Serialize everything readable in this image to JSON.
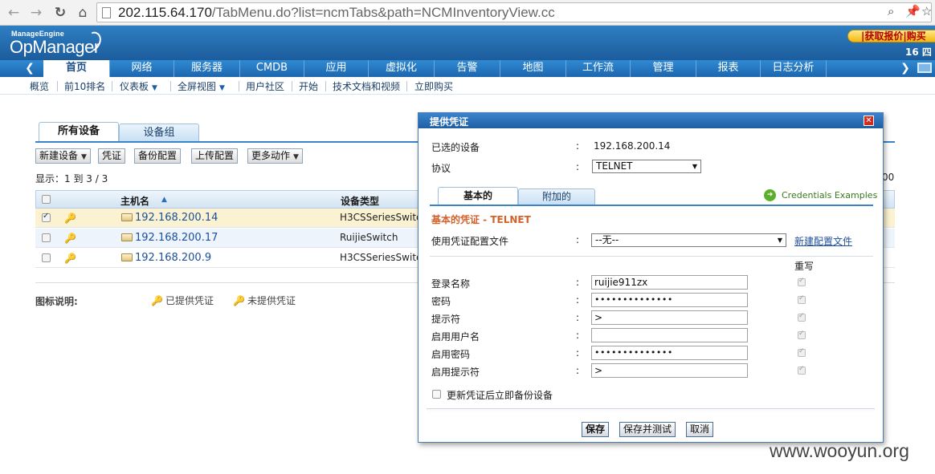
{
  "browser": {
    "url_host": "202.115.64.170",
    "url_path": "/TabMenu.do?list=ncmTabs&path=NCMInventoryView.cc"
  },
  "header": {
    "logo_small": "ManageEngine",
    "logo_big": "OpManager",
    "quote_button": "|获取报价|购买",
    "date_text": "16 四"
  },
  "main_nav": {
    "tabs": [
      {
        "label": "首页"
      },
      {
        "label": "网络"
      },
      {
        "label": "服务器"
      },
      {
        "label": "CMDB"
      },
      {
        "label": "应用"
      },
      {
        "label": "虚拟化"
      },
      {
        "label": "告警"
      },
      {
        "label": "地图"
      },
      {
        "label": "工作流"
      },
      {
        "label": "管理"
      },
      {
        "label": "报表"
      },
      {
        "label": "日志分析"
      }
    ]
  },
  "sub_nav": {
    "items": [
      {
        "label": "概览"
      },
      {
        "label": "前10排名"
      },
      {
        "label": "仪表板"
      },
      {
        "label": "全屏视图"
      },
      {
        "label": "用户社区"
      },
      {
        "label": "开始"
      },
      {
        "label": "技术文档和视频"
      },
      {
        "label": "立即购买"
      }
    ]
  },
  "inventory": {
    "tabs": {
      "all": "所有设备",
      "group": "设备组"
    },
    "toolbar": {
      "new_device": "新建设备",
      "credential": "凭证",
      "backup": "备份配置",
      "upload": "上传配置",
      "more": "更多动作"
    },
    "show_count": "显示：1 到 3 / 3",
    "right_fragment": "00",
    "columns": {
      "host": "主机名",
      "type": "设备类型"
    },
    "rows": [
      {
        "host": "192.168.200.14",
        "type": "H3CSSeriesSwitc",
        "checked": true
      },
      {
        "host": "192.168.200.17",
        "type": "RuijieSwitch",
        "checked": false
      },
      {
        "host": "192.168.200.9",
        "type": "H3CSSeriesSwitc",
        "checked": false
      }
    ],
    "legend": {
      "label": "图标说明:",
      "provided": "已提供凭证",
      "not_provided": "未提供凭证"
    }
  },
  "dialog": {
    "title": "提供凭证",
    "selected_device_label": "已选的设备",
    "selected_device_value": "192.168.200.14",
    "protocol_label": "协议",
    "protocol_value": "TELNET",
    "tab_basic": "基本的",
    "tab_extra": "附加的",
    "credentials_examples": "Credentials Examples",
    "section_title": "基本的凭证 - TELNET",
    "profile_label": "使用凭证配置文件",
    "profile_value": "--无--",
    "new_profile_link": "新建配置文件",
    "rewrite_header": "重写",
    "fields": [
      {
        "label": "登录名称",
        "value": "ruijie911zx"
      },
      {
        "label": "密码",
        "value": "••••••••••••••"
      },
      {
        "label": "提示符",
        "value": ">"
      },
      {
        "label": "启用用户名",
        "value": ""
      },
      {
        "label": "启用密码",
        "value": "••••••••••••••"
      },
      {
        "label": "启用提示符",
        "value": ">"
      }
    ],
    "backup_after_update": "更新凭证后立即备份设备",
    "buttons": {
      "save": "保存",
      "save_test": "保存并测试",
      "cancel": "取消"
    }
  },
  "watermark": "www.wooyun.org"
}
